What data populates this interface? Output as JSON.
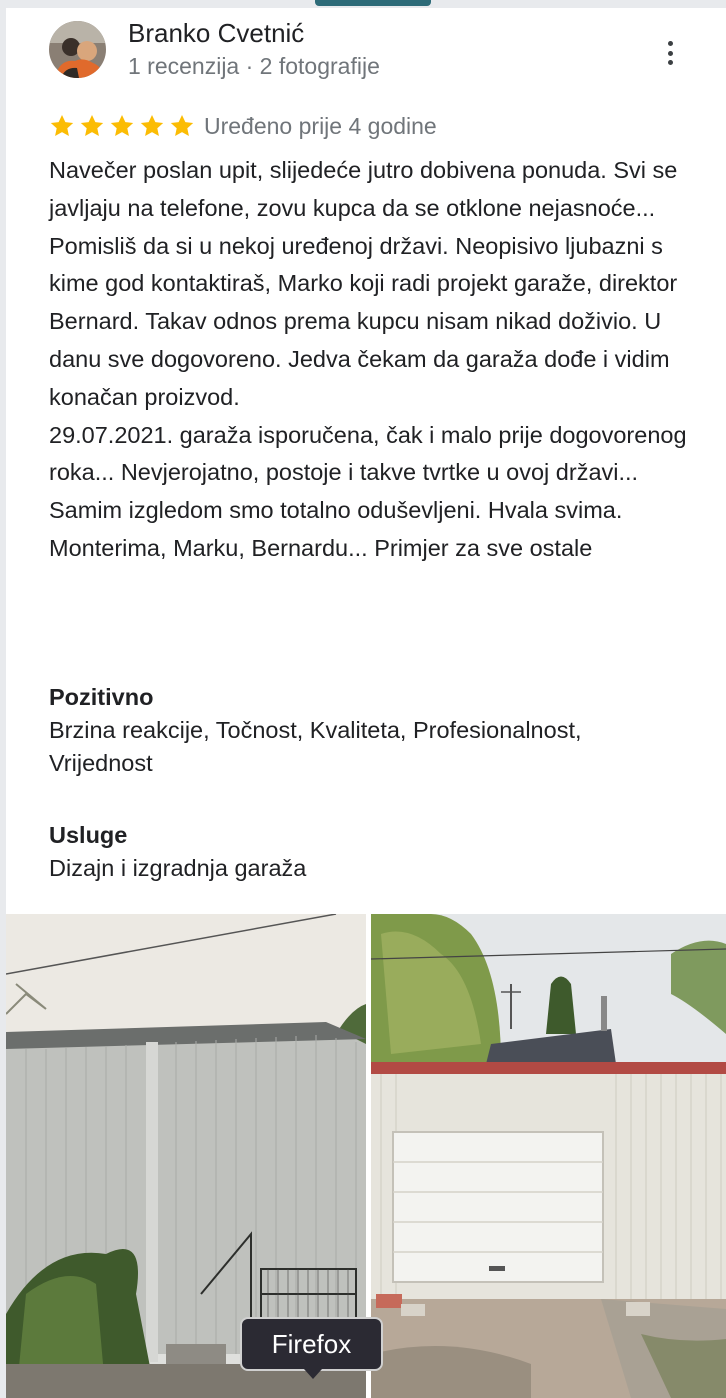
{
  "reviewer": {
    "name": "Branko Cvetnić",
    "meta": "1 recenzija · 2 fotografije"
  },
  "rating": {
    "stars": 5,
    "max": 5,
    "color": "#fbbc04"
  },
  "edited": "Uređeno prije 4 godine",
  "review_text": "Navečer poslan upit, slijedeće jutro dobivena ponuda. Svi se javljaju na telefone, zovu kupca da se otklone nejasnoće... Pomisliš da si u nekoj uređenoj državi. Neopisivo ljubazni s kime god kontaktiraš, Marko koji radi projekt garaže, direktor Bernard. Takav odnos prema kupcu nisam nikad doživio. U danu sve dogovoreno. Jedva čekam da garaža dođe i vidim konačan proizvod.\n29.07.2021. garaža isporučena, čak i malo prije dogovorenog roka... Nevjerojatno, postoje i takve tvrtke u ovoj državi... Samim izgledom smo totalno oduševljeni. Hvala svima. Monterima, Marku, Bernardu... Primjer za sve ostale",
  "sections": [
    {
      "title": "Pozitivno",
      "value": "Brzina reakcije, Točnost, Kvaliteta, Profesionalnost, Vrijednost"
    },
    {
      "title": "Usluge",
      "value": "Dizajn i izgradnja garaža"
    }
  ],
  "photos": [
    {
      "icon": "garage-side-photo"
    },
    {
      "icon": "garage-door-photo"
    }
  ],
  "tooltip": "Firefox",
  "icons": {
    "more": "more-vert-icon",
    "star": "star-icon"
  }
}
